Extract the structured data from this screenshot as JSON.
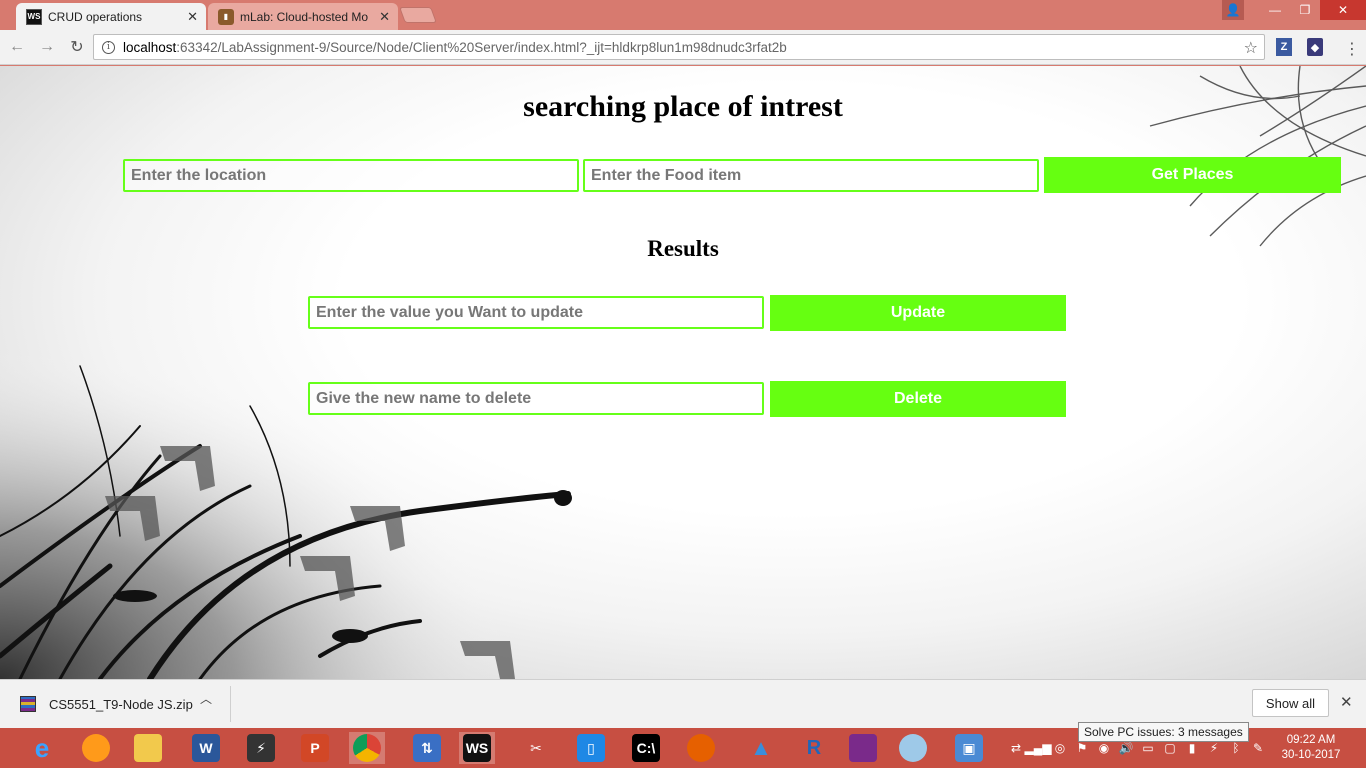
{
  "browser": {
    "tabs": [
      {
        "title": "CRUD operations",
        "favicon": "WS",
        "active": true
      },
      {
        "title": "mLab: Cloud-hosted Mo",
        "favicon": "M",
        "active": false
      }
    ],
    "url_host": "localhost",
    "url_rest": ":63342/LabAssignment-9/Source/Node/Client%20Server/index.html?_ijt=hldkrp8lun1m98dnudc3rfat2b",
    "extensions": [
      "Z",
      ""
    ]
  },
  "page": {
    "title": "searching place of intrest",
    "results_title": "Results",
    "location_placeholder": "Enter the location",
    "food_placeholder": "Enter the Food item",
    "get_places_label": "Get Places",
    "update_placeholder": "Enter the value you Want to update",
    "update_label": "Update",
    "delete_placeholder": "Give the new name to delete",
    "delete_label": "Delete",
    "accent_color": "#66ff11"
  },
  "downloads": {
    "file_name": "CS5551_T9-Node JS.zip",
    "show_all_label": "Show all"
  },
  "taskbar": {
    "notification": "Solve PC issues: 3 messages",
    "time": "09:22 AM",
    "date": "30-10-2017"
  }
}
